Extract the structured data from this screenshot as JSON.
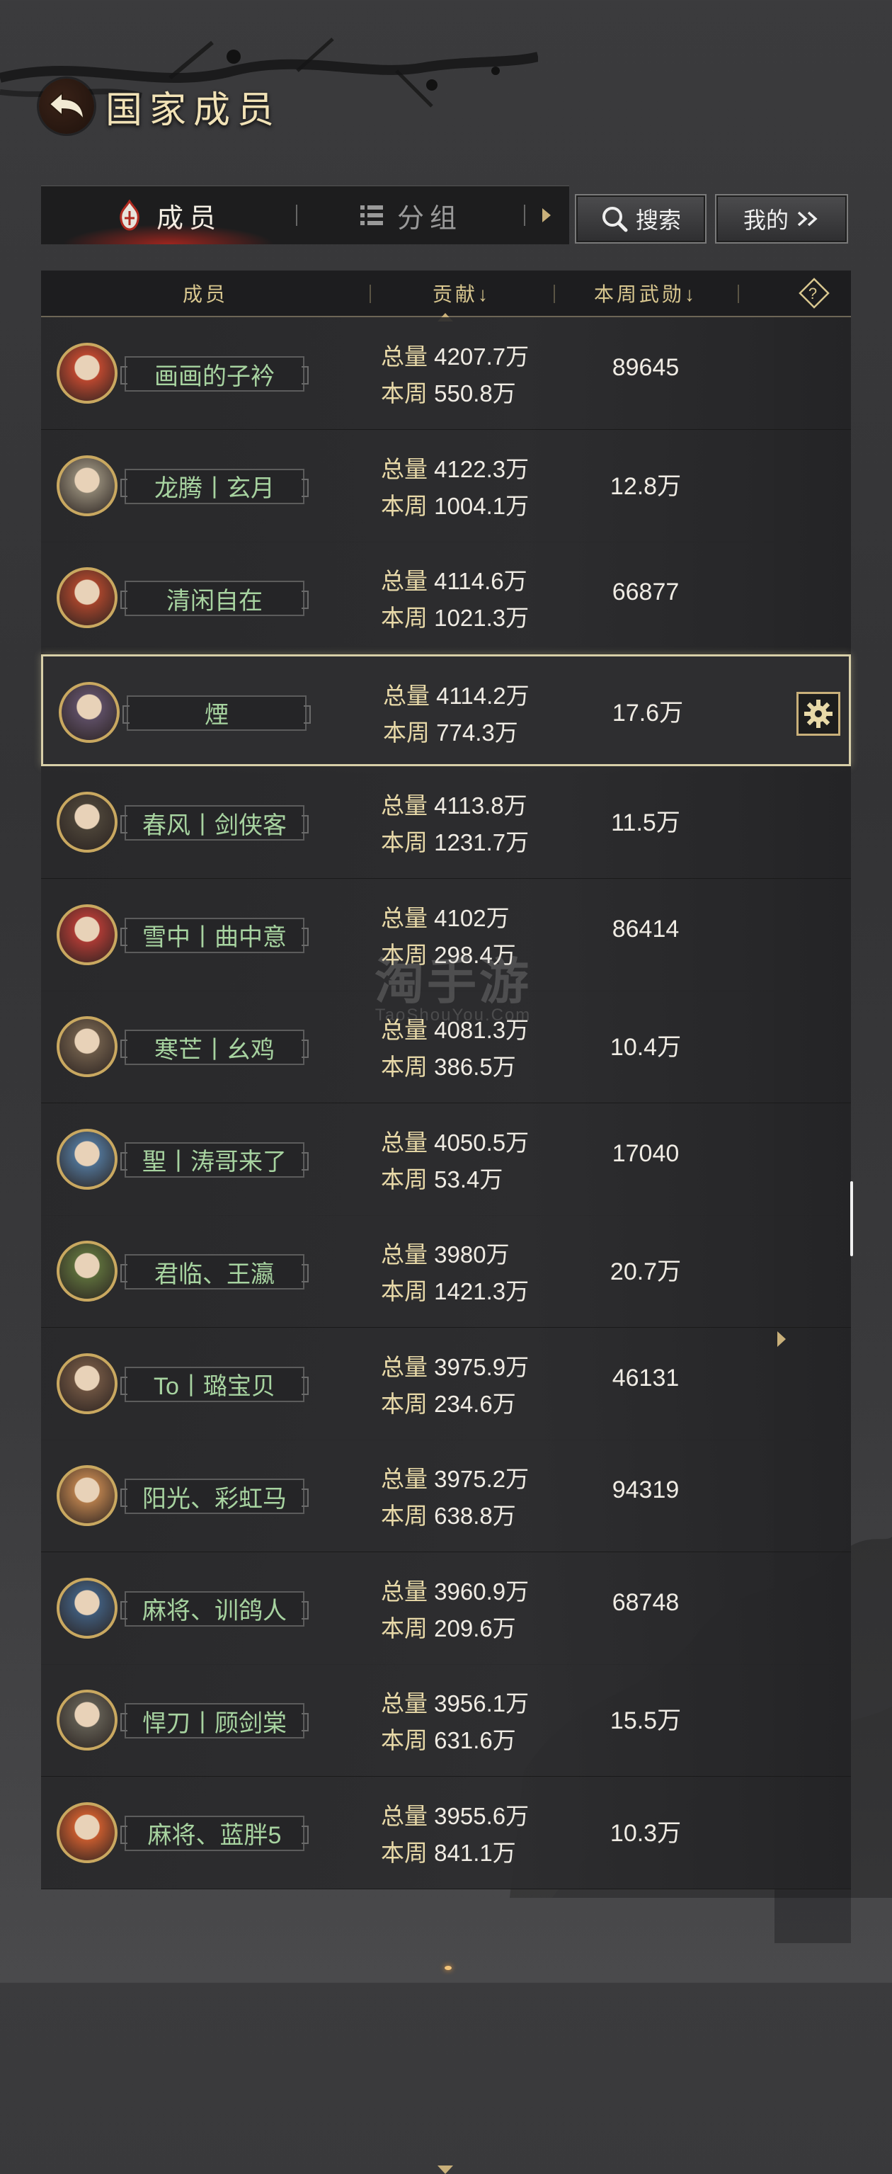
{
  "header": {
    "title": "国家成员"
  },
  "tabs": [
    {
      "label": "成员",
      "icon": "flame-emblem-icon",
      "active": true
    },
    {
      "label": "分组",
      "icon": "list-icon",
      "active": false
    }
  ],
  "buttons": {
    "search_label": "搜索",
    "mine_label": "我的"
  },
  "table": {
    "headers": {
      "member": "成员",
      "contribution": "贡献↓",
      "weekly_merit": "本周武勋↓",
      "help": "?"
    },
    "total_label": "总量",
    "week_label": "本周",
    "rows": [
      {
        "name": "画画的子衿",
        "total": "4207.7万",
        "week": "550.8万",
        "merit": "89645",
        "avatar_color": "#b9472f"
      },
      {
        "name": "龙腾丨玄月",
        "total": "4122.3万",
        "week": "1004.1万",
        "merit": "12.8万",
        "avatar_color": "#8a8170"
      },
      {
        "name": "清闲自在",
        "total": "4114.6万",
        "week": "1021.3万",
        "merit": "66877",
        "avatar_color": "#a3442c"
      },
      {
        "name": "煙",
        "total": "4114.2万",
        "week": "774.3万",
        "merit": "17.6万",
        "avatar_color": "#5b4c62",
        "selected": true
      },
      {
        "name": "春风丨剑侠客",
        "total": "4113.8万",
        "week": "1231.7万",
        "merit": "11.5万",
        "avatar_color": "#4a4237"
      },
      {
        "name": "雪中丨曲中意",
        "total": "4102万",
        "week": "298.4万",
        "merit": "86414",
        "avatar_color": "#a93a34"
      },
      {
        "name": "寒芒丨幺鸡",
        "total": "4081.3万",
        "week": "386.5万",
        "merit": "10.4万",
        "avatar_color": "#6b5a48"
      },
      {
        "name": "聖丨涛哥来了",
        "total": "4050.5万",
        "week": "53.4万",
        "merit": "17040",
        "avatar_color": "#4e6f8f"
      },
      {
        "name": "君临、王瀛",
        "total": "3980万",
        "week": "1421.3万",
        "merit": "20.7万",
        "avatar_color": "#5a6a3a"
      },
      {
        "name": "To丨璐宝贝",
        "total": "3975.9万",
        "week": "234.6万",
        "merit": "46131",
        "avatar_color": "#6b5240"
      },
      {
        "name": "阳光、彩虹马",
        "total": "3975.2万",
        "week": "638.8万",
        "merit": "94319",
        "avatar_color": "#b07a4a"
      },
      {
        "name": "麻将、训鸽人",
        "total": "3960.9万",
        "week": "209.6万",
        "merit": "68748",
        "avatar_color": "#3f5a78"
      },
      {
        "name": "悍刀丨顾剑棠",
        "total": "3956.1万",
        "week": "631.6万",
        "merit": "15.5万",
        "avatar_color": "#5e5a50"
      },
      {
        "name": "麻将、蓝胖5",
        "total": "3955.6万",
        "week": "841.1万",
        "merit": "10.3万",
        "avatar_color": "#c35a2e"
      }
    ]
  },
  "watermark": {
    "main": "淘手游",
    "sub": "TaoShouYou.Com"
  },
  "colors": {
    "gold": "#d9c78f",
    "name_green": "#a7d3a0",
    "accent_red": "#c8281e"
  }
}
